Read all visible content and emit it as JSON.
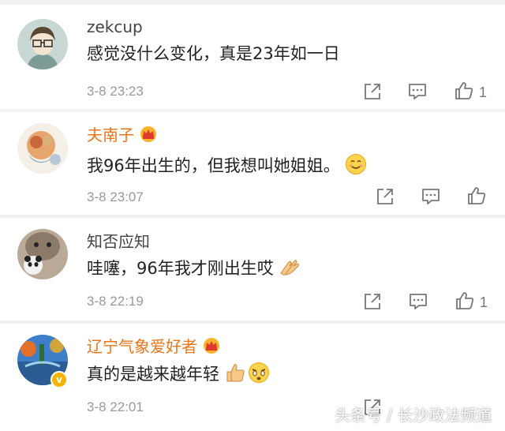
{
  "comments": [
    {
      "username": "zekcup",
      "text": "感觉没什么变化，真是23年如一日",
      "time": "3-8 23:23",
      "likes": "1",
      "vip": false,
      "verified": false
    },
    {
      "username": "夫南子",
      "text": "我96年出生的，但我想叫她姐姐。",
      "time": "3-8 23:07",
      "likes": "",
      "vip": true,
      "verified": false,
      "emoji": "smiling-face-icon"
    },
    {
      "username": "知否应知",
      "text": "哇噻，96年我才刚出生哎",
      "time": "3-8 22:19",
      "likes": "1",
      "vip": false,
      "verified": false,
      "emoji": "clapping-hands-icon"
    },
    {
      "username": "辽宁气象爱好者",
      "text": "真的是越来越年轻",
      "time": "3-8 22:01",
      "likes": "",
      "vip": true,
      "verified": true,
      "emoji": [
        "thumbs-up-icon",
        "astonished-face-icon"
      ]
    }
  ],
  "watermark": "头条号 / 长沙政法频道",
  "colors": {
    "vip_name": "#e8751a",
    "name": "#444444",
    "text": "#222222",
    "meta": "#999999",
    "divider": "#f2f2f2"
  }
}
